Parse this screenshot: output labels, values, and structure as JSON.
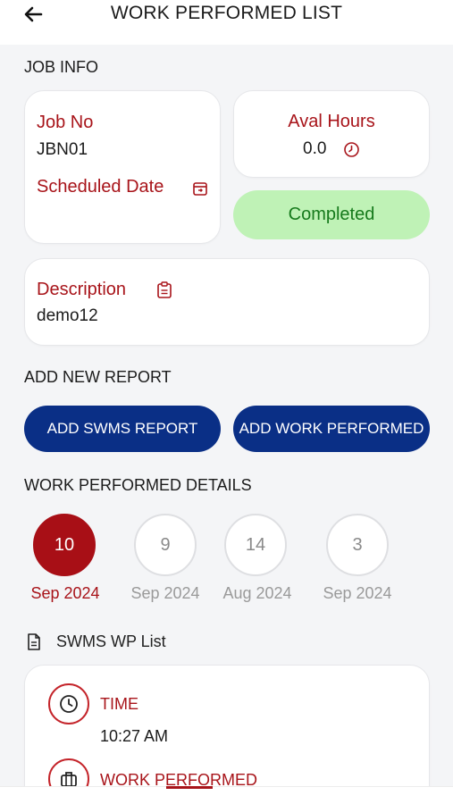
{
  "header": {
    "title": "WORK PERFORMED LIST"
  },
  "job_info": {
    "section_label": "JOB INFO",
    "job_no_label": "Job No",
    "job_no_value": "JBN01",
    "scheduled_date_label": "Scheduled Date",
    "aval_hours_label": "Aval Hours",
    "aval_hours_value": "0.0",
    "status": "Completed",
    "description_label": "Description",
    "description_value": "demo12"
  },
  "add_report": {
    "section_label": "ADD NEW REPORT",
    "swms_button": "ADD SWMS REPORT",
    "work_button": "ADD WORK PERFORMED"
  },
  "details": {
    "section_label": "WORK PERFORMED DETAILS",
    "dates": [
      {
        "day": "10",
        "month": "Sep 2024",
        "active": true
      },
      {
        "day": "9",
        "month": "Sep 2024",
        "active": false
      },
      {
        "day": "14",
        "month": "Aug 2024",
        "active": false
      },
      {
        "day": "3",
        "month": "Sep 2024",
        "active": false
      }
    ]
  },
  "swms_list": {
    "label": "SWMS WP List",
    "time_label": "TIME",
    "time_value": "10:27 AM",
    "work_label": "WORK PERFORMED"
  },
  "colors": {
    "accent": "#a8141a",
    "primary_button": "#0a2f86",
    "status_bg": "#bff2b6",
    "status_text": "#167a1c"
  },
  "icons": [
    "back-arrow-icon",
    "calendar-icon",
    "clock-icon",
    "clipboard-icon",
    "document-icon",
    "clock-icon",
    "briefcase-icon"
  ]
}
